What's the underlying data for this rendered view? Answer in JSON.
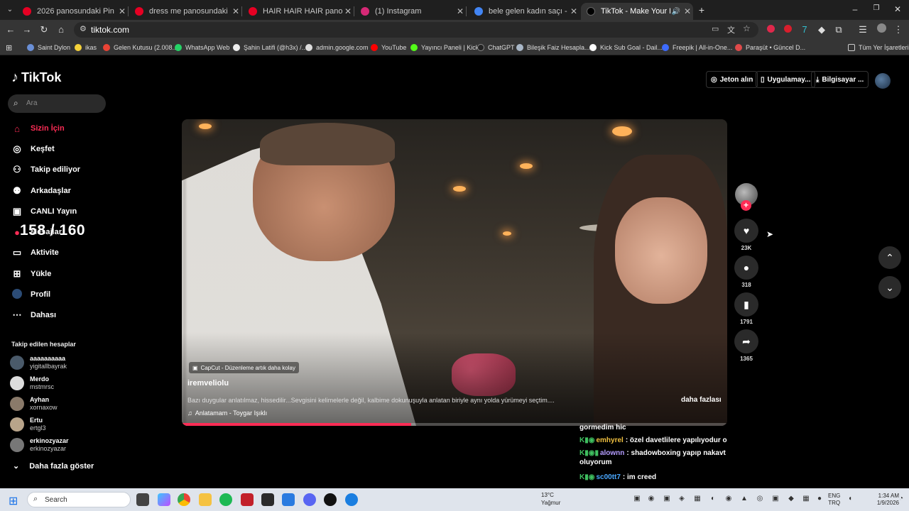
{
  "browser": {
    "tabs": [
      {
        "title": "2026 panosundaki Pin",
        "favicon_color": "#e60023",
        "active": false
      },
      {
        "title": "dress me panosundaki Pin",
        "favicon_color": "#e60023",
        "active": false
      },
      {
        "title": "HAIR HAIR HAIR panosundaki Pin",
        "favicon_color": "#e60023",
        "active": false
      },
      {
        "title": "(1) Instagram",
        "favicon_color": "#d62976",
        "active": false
      },
      {
        "title": "bele gelen kadın saçı - Google",
        "favicon_color": "#4285f4",
        "active": false
      },
      {
        "title": "TikTok - Make Your Day",
        "favicon_color": "#000000",
        "active": true
      }
    ],
    "url": "tiktok.com",
    "bookmarks": [
      "Saint Dylon",
      "ikas",
      "Gelen Kutusu (2.008...",
      "WhatsApp Web",
      "Şahin Latifi (@h3x) /...",
      "admin.google.com",
      "YouTube",
      "Yayıncı Paneli | Kick",
      "ChatGPT",
      "Bileşik Faiz Hesapla...",
      "Kick Sub Goal - Dail...",
      "Freepik | All-in-One...",
      "Paraşüt • Güncel D..."
    ],
    "all_bookmarks": "Tüm Yer İşaretleri"
  },
  "tiktok": {
    "logo": "TikTok",
    "search_placeholder": "Ara",
    "nav": [
      {
        "label": "Sizin İçin",
        "icon": "home-icon",
        "active": true
      },
      {
        "label": "Keşfet",
        "icon": "compass-icon",
        "active": false
      },
      {
        "label": "Takip ediliyor",
        "icon": "user-plus-icon",
        "active": false
      },
      {
        "label": "Arkadaşlar",
        "icon": "friends-icon",
        "active": false
      },
      {
        "label": "CANLI Yayın",
        "icon": "live-icon",
        "active": false
      },
      {
        "label": "Mesajlar",
        "icon": "message-icon",
        "active": false
      },
      {
        "label": "Aktivite",
        "icon": "activity-icon",
        "active": false
      },
      {
        "label": "Yükle",
        "icon": "upload-icon",
        "active": false
      },
      {
        "label": "Profil",
        "icon": "profile-icon",
        "active": false
      },
      {
        "label": "Dahası",
        "icon": "more-icon",
        "active": false
      }
    ],
    "counter_overlay": "158 / 160",
    "following_title": "Takip edilen hesaplar",
    "following": [
      {
        "name": "aaaaaaaaaa",
        "handle": "yigitallbayrak"
      },
      {
        "name": "Merdo",
        "handle": "mstmrsc"
      },
      {
        "name": "Ayhan",
        "handle": "xornaxow"
      },
      {
        "name": "Ertu",
        "handle": "ertgl3"
      },
      {
        "name": "erkinozyazar",
        "handle": "erkinozyazar"
      }
    ],
    "show_more": "Daha fazla göster",
    "top_buttons": {
      "coins": "Jeton alın",
      "app": "Uygulamay...",
      "desktop": "Bilgisayar ..."
    },
    "video": {
      "capcut": "CapCut - Düzenleme artık daha kolay",
      "author": "iremveliolu",
      "caption": "Bazı duygular anlatılmaz, hissedilir...Sevgisini kelimelerle değil, kalbime dokunuşuyla anlatan biriyle aynı yolda yürümeyi seçtim....",
      "more": "daha fazlası",
      "music": "Anlatamam - Toygar Işıklı",
      "progress": 0.42
    },
    "actions": {
      "likes": "23K",
      "comments": "318",
      "saves": "1791",
      "shares": "1365"
    }
  },
  "chat": [
    {
      "user": "",
      "text": "gormedim hic",
      "user_color": "#ffffff"
    },
    {
      "user": "emhyrel",
      "text": ": özel davetlilere yapılıyodur o",
      "user_color": "#f0c040"
    },
    {
      "user": "alownn",
      "text": ": shadowboxing yapıp nakavt oluyorum",
      "user_color": "#b49cff"
    },
    {
      "user": "sc00tt7",
      "text": ": im creed",
      "user_color": "#4aa8ff"
    }
  ],
  "taskbar": {
    "search": "Search",
    "weather_temp": "13°C",
    "weather_desc": "Yağmur",
    "lang1": "ENG",
    "lang2": "TRQ",
    "time": "1:34 AM",
    "date": "1/9/2026"
  }
}
